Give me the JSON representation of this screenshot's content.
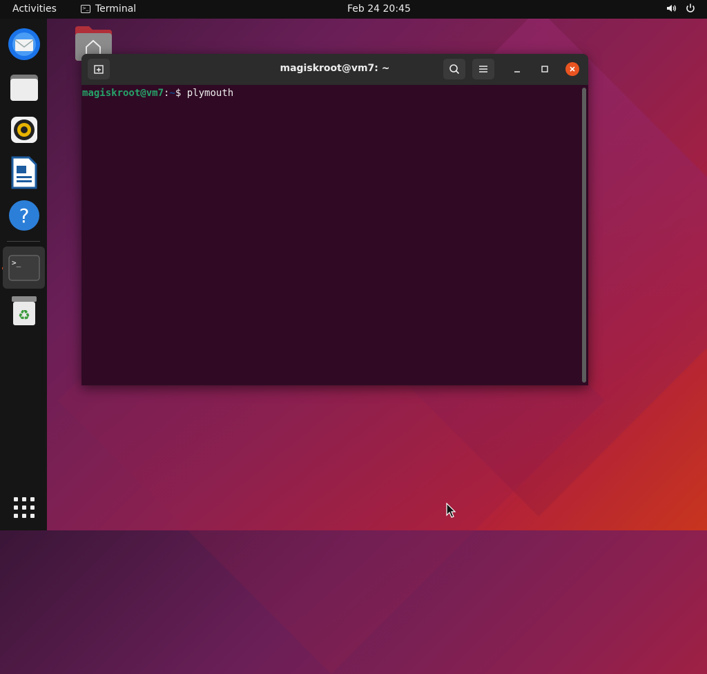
{
  "topbar": {
    "activities": "Activities",
    "app_name": "Terminal",
    "clock": "Feb 24  20:45"
  },
  "dock": {
    "items": [
      {
        "name": "thunderbird",
        "icon": "mail-icon"
      },
      {
        "name": "files",
        "icon": "folder-icon"
      },
      {
        "name": "rhythmbox",
        "icon": "speaker-icon"
      },
      {
        "name": "libreoffice-writer",
        "icon": "document-icon"
      },
      {
        "name": "help",
        "icon": "question-icon"
      },
      {
        "name": "terminal",
        "icon": "terminal-icon",
        "running": true
      },
      {
        "name": "trash",
        "icon": "trash-icon"
      }
    ],
    "show_apps_icon": "grid-icon"
  },
  "terminal": {
    "title": "magiskroot@vm7: ~",
    "prompt_user": "magiskroot@vm7",
    "prompt_colon": ":",
    "prompt_path": "~",
    "prompt_symbol": "$ ",
    "command": "plymouth"
  },
  "colors": {
    "accent": "#e95420",
    "terminal_bg": "#300a24",
    "prompt_user": "#26a269",
    "prompt_path": "#12488b"
  }
}
